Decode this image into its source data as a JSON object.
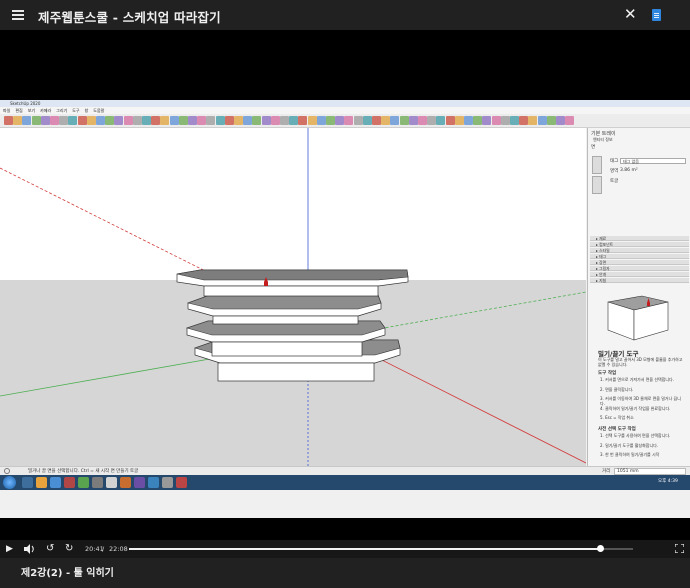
{
  "header": {
    "title": "제주웹툰스쿨 - 스케치업 따라잡기",
    "menu_icon": "hamburger-menu-icon",
    "close_icon": "close-icon",
    "doc_icon": "document-icon"
  },
  "video": {
    "current_time": "20:41",
    "separator": "/",
    "duration": "22:08",
    "progress": 0.9345
  },
  "lesson": {
    "title": "제2강(2) - 툴 익히기"
  },
  "screen_content": {
    "status_text": "밀거나 끌 면을 선택합니다. Ctrl = 새 시작 면 만들기 토글",
    "measure_label": "거리",
    "measure_value": "1051 mm",
    "tray_title": "기본 트레이",
    "entity_info_title": "엔티티 정보",
    "entity_type": "면",
    "layer_label": "태그",
    "layer_value": "태그 없음",
    "area_label": "영역",
    "area_value": "3.86 m²",
    "toggle_label": "토글",
    "trays": [
      "재료",
      "컴포넌트",
      "스타일",
      "태그",
      "장면",
      "그림자",
      "안개",
      "지침"
    ],
    "instructor_title": "밀기/끌기 도구",
    "instructor_desc": "이 도구를 밀고 끌어서 3D 모형에 볼륨을 추가하고 없앨 수 있습니다.",
    "tool_ops_title": "도구 작업",
    "tool_ops": [
      "1. 커서를 면으로 가져가서 면을 선택합니다.",
      "2. 면을 클릭합니다.",
      "3. 커서를 이동하여 3D 물체로 면을 밀거나 끕니다.",
      "4. 클릭하여 밀기/끌기 작업을 완료합니다.",
      "5. Esc = 작업 취소"
    ],
    "preselect_title": "사전 선택 도구 작업",
    "preselect_ops": [
      "1. 선택 도구를 사용하여 면을 선택합니다.",
      "2. 밀기/끌기 도구를 활성화합니다.",
      "3. 한 번 클릭하여 밀기/끌기를 시작"
    ],
    "taskbar_time": "오후 4:39"
  },
  "colors": {
    "accent": "#2e86de",
    "taskbar": "#25486d",
    "axis_red": "#d33b3b",
    "axis_green": "#4caf50",
    "axis_blue": "#3b5bd3"
  }
}
